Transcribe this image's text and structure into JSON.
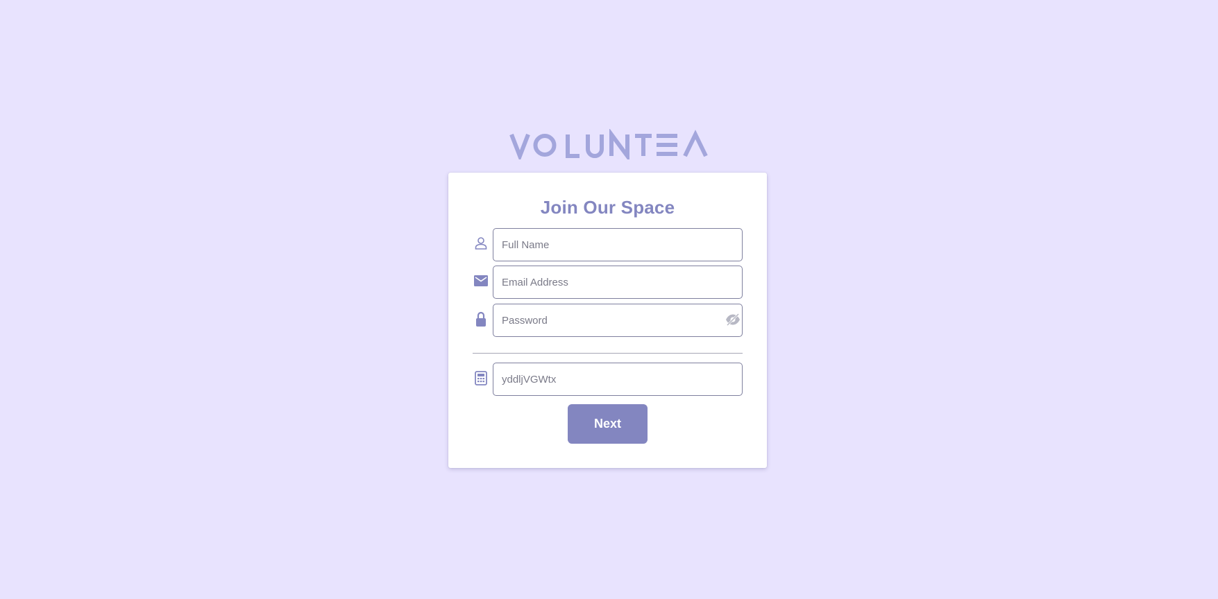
{
  "brand": {
    "logo_text": "VOLUNTEA",
    "color": "#a3a6dc"
  },
  "colors": {
    "background": "#e8e3fe",
    "accent": "#8386c0",
    "field_border": "#7e7f9e"
  },
  "form": {
    "title": "Join Our Space",
    "full_name": {
      "placeholder": "Full Name",
      "value": "",
      "icon": "person-icon"
    },
    "email": {
      "placeholder": "Email Address",
      "value": "",
      "icon": "envelope-icon"
    },
    "password": {
      "placeholder": "Password",
      "value": "",
      "icon": "lock-icon",
      "toggle_icon": "eye-slash-icon"
    },
    "captcha": {
      "placeholder": "yddljVGWtx",
      "value": "",
      "icon": "calculator-icon"
    },
    "submit_label": "Next"
  }
}
